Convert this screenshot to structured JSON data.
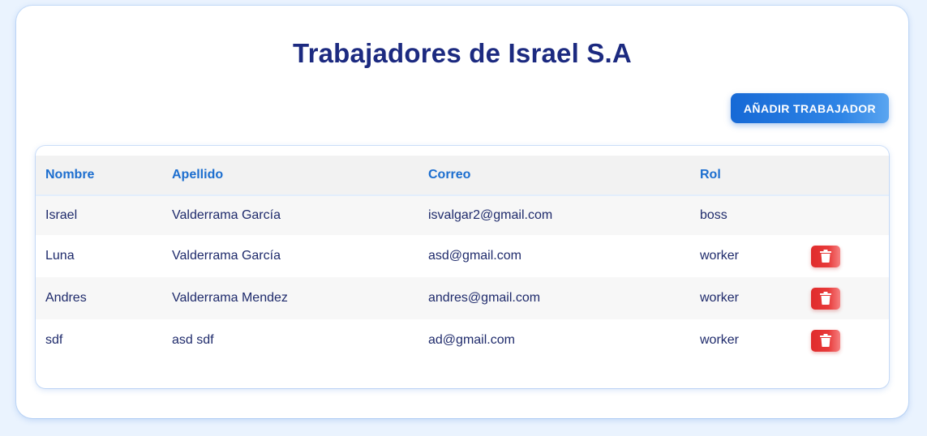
{
  "page": {
    "title": "Trabajadores de Israel S.A",
    "add_button_label": "AÑADIR TRABAJADOR"
  },
  "table": {
    "columns": [
      "Nombre",
      "Apellido",
      "Correo",
      "Rol",
      ""
    ],
    "rows": [
      {
        "nombre": "Israel",
        "apellido": "Valderrama García",
        "correo": "isvalgar2@gmail.com",
        "rol": "boss",
        "deletable": false
      },
      {
        "nombre": "Luna",
        "apellido": "Valderrama García",
        "correo": "asd@gmail.com",
        "rol": "worker",
        "deletable": true,
        "delete_icon": "trash-icon"
      },
      {
        "nombre": "Andres",
        "apellido": "Valderrama Mendez",
        "correo": "andres@gmail.com",
        "rol": "worker",
        "deletable": true,
        "delete_icon": "trash-icon"
      },
      {
        "nombre": "sdf",
        "apellido": "asd sdf",
        "correo": "ad@gmail.com",
        "rol": "worker",
        "deletable": true,
        "delete_icon": "trash-icon"
      }
    ]
  },
  "colors": {
    "title": "#1c2a80",
    "header_text": "#1c6ecf",
    "primary_button": "#1669d6",
    "delete_button": "#e02b2b"
  }
}
